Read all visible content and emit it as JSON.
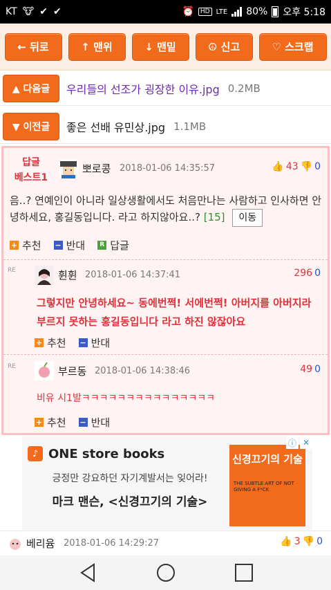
{
  "status_bar": {
    "carrier": "KT",
    "hd": "HD",
    "lte": "LTE",
    "battery": "80%",
    "time": "오후 5:18"
  },
  "toolbar": {
    "back": "← 뒤로",
    "top": "↑ 맨위",
    "bottom": "↓ 맨밑",
    "report": "☮ 신고",
    "scrap": "♡ 스크랩"
  },
  "next_post": {
    "button": "▲ 다음글",
    "title": "우리들의 선조가 굉장한 이유.jpg",
    "size": "0.2MB"
  },
  "prev_post": {
    "button": "▼ 이전글",
    "title": "좋은 선배 유민상.jpg",
    "size": "1.1MB"
  },
  "best_reply": {
    "label_line1": "답글",
    "label_line2": "베스트1",
    "author": "뽀로콩",
    "date": "2018-01-06 14:35:57",
    "up": "43",
    "down": "0",
    "text": "음..? 연예인이 아니라 일상생활에서도 처음만나는 사람하고 인사하면 안녕하세요, 홍길동입니다. 라고 하지않아요..?",
    "reply_count": "[15]",
    "move_button": "이동",
    "recommend": "추천",
    "oppose": "반대",
    "reply": "답글"
  },
  "sub_replies": [
    {
      "re": "RE",
      "author": "휜휜",
      "date": "2018-01-06 14:37:41",
      "up": "296",
      "down": "0",
      "text": "그렇지만 안녕하세요~ 동에번쩍! 서에번쩍! 아버지를 아버지라 부르지 못하는 홍길동입니다 라고 하진 않잖아요",
      "recommend": "추천",
      "oppose": "반대"
    },
    {
      "re": "RE",
      "author": "부르동",
      "date": "2018-01-06 14:38:46",
      "up": "49",
      "down": "0",
      "text": "비유 시1발ㅋㅋㅋㅋㅋㅋㅋㅋㅋㅋㅋㅋㅋㅋㅋ",
      "recommend": "추천",
      "oppose": "반대"
    }
  ],
  "ad": {
    "brand": "ONE store books",
    "line1": "긍정만 강요하던 자기계발서는 잊어라!",
    "line2": "마크 맨슨, <신경끄기의 기술>",
    "book_title": "신경끄기의 기술",
    "book_sub": "THE SUBTLE ART OF NOT GIVING A F*CK"
  },
  "next_comment": {
    "author": "베리윰",
    "date": "2018-01-06 14:29:27",
    "up": "3",
    "down": "0"
  },
  "colors": {
    "accent": "#f26b1d",
    "red": "#e0313a",
    "blue": "#2a50c8",
    "visited_link": "#6a2bb0"
  }
}
